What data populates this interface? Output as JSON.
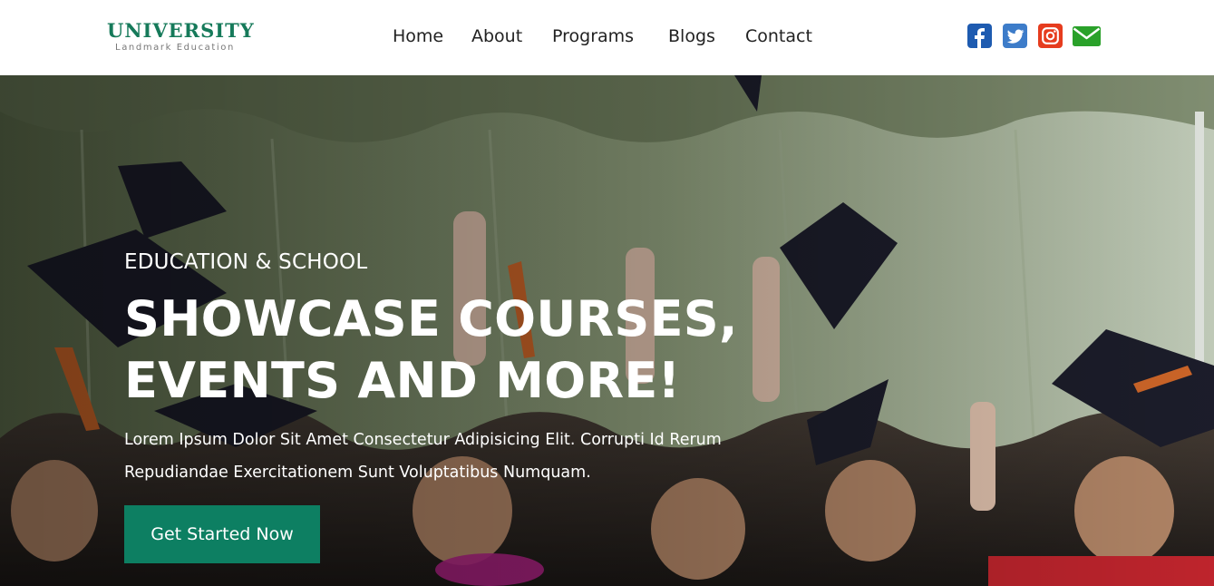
{
  "brand": {
    "name": "UNIVERSITY",
    "tagline": "Landmark Education",
    "color": "#167a5a"
  },
  "nav": {
    "items": [
      {
        "label": "Home"
      },
      {
        "label": "About"
      },
      {
        "label": "Programs"
      },
      {
        "label": "Blogs"
      },
      {
        "label": "Contact"
      }
    ]
  },
  "social": {
    "items": [
      {
        "icon": "facebook-icon",
        "color": "#1e5bb0"
      },
      {
        "icon": "twitter-icon",
        "color": "#3d7cc9"
      },
      {
        "icon": "instagram-icon",
        "color": "#e63c1e"
      },
      {
        "icon": "envelope-icon",
        "color": "#2aa12a"
      }
    ]
  },
  "hero": {
    "kicker": "EDUCATION & SCHOOL",
    "title": "SHOWCASE COURSES, EVENTS AND MORE!",
    "description": "Lorem Ipsum Dolor Sit Amet Consectetur Adipisicing Elit. Corrupti Id Rerum Repudiandae Exercitationem Sunt Voluptatibus Numquam.",
    "cta_label": "Get Started Now",
    "cta_color": "#0d7f62"
  }
}
